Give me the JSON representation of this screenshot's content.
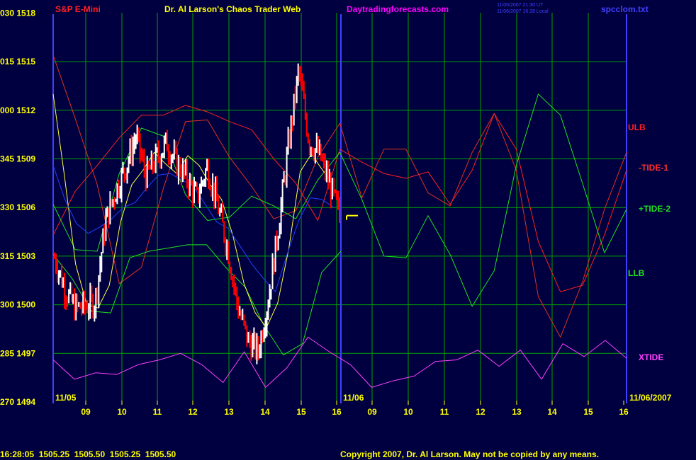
{
  "header": {
    "instrument": "S&P E-Mini",
    "title": "Dr. Al Larson's Chaos Trader Web",
    "site": "Daytradingforecasts.com",
    "time_line_1": "11/05/2007 21:30 UT",
    "time_line_2": "11/06/2007 16:28 Local",
    "file": "spcclom.txt"
  },
  "footer": {
    "quote": "16:28:05  1505.25  1505.50  1505.25  1505.50",
    "copyright": "Copyright 2007, Dr. Al Larson. May not be copied by any means."
  },
  "colors": {
    "background": "#000040",
    "grid": "#00A000",
    "axis": "#4040FF",
    "yellow": "#FFFF00",
    "magenta": "#FF00FF",
    "ulb": "#FF2020",
    "tide1": "#E03020",
    "tide2": "#20E020",
    "llb": "#20E020",
    "xtide": "#FF40FF",
    "price_up": "#FFFFFF",
    "price_down": "#FF0000",
    "ma_yellow": "#FFFF40",
    "ma_blue": "#2040FF"
  },
  "chart_data": {
    "type": "line",
    "y_axis_ticks": [
      {
        "osc": "030",
        "price": "1518"
      },
      {
        "osc": "015",
        "price": "1515"
      },
      {
        "osc": "000",
        "price": "1512"
      },
      {
        "osc": "345",
        "price": "1509"
      },
      {
        "osc": "330",
        "price": "1506"
      },
      {
        "osc": "315",
        "price": "1503"
      },
      {
        "osc": "300",
        "price": "1500"
      },
      {
        "osc": "285",
        "price": "1497"
      },
      {
        "osc": "270",
        "price": "1494"
      }
    ],
    "ylim": [
      1494,
      1518
    ],
    "x_tick_labels": [
      "09",
      "10",
      "11",
      "12",
      "13",
      "14",
      "15",
      "16",
      "09",
      "10",
      "11",
      "12",
      "13",
      "14",
      "15",
      "16"
    ],
    "date_labels": {
      "day1": "11/05",
      "day2": "11/06",
      "right": "11/06/2007"
    },
    "line_labels": [
      {
        "name": "ULB",
        "color": "#FF2020"
      },
      {
        "name": "-TIDE-1",
        "color": "#FF3030"
      },
      {
        "name": "+TIDE-2",
        "color": "#20E020"
      },
      {
        "name": "LLB",
        "color": "#20E020"
      },
      {
        "name": "XTIDE",
        "color": "#FF40FF"
      }
    ],
    "grid": true,
    "series": [
      {
        "name": "ULB",
        "values": [
          1504.3,
          1507.0,
          1508.6,
          1510.3,
          1511.7,
          1511.7,
          1512.3,
          1511.9,
          1511.3,
          1510.8,
          1509.0,
          1507.5,
          1505.2,
          1509.6,
          1508.8,
          1508.1,
          1507.8,
          1508.2,
          1506.2,
          1508.3,
          1511.8,
          1509.6,
          1503.9,
          1500.8,
          1501.2,
          1504.3,
          1508.3
        ]
      },
      {
        "name": "-TIDE-1",
        "values": [
          1515.4,
          1511.5,
          1507.4,
          1501.3,
          1502.3,
          1507.2,
          1511.3,
          1511.4,
          1509.1,
          1507.3,
          1505.3,
          1505.8,
          1509.1,
          1511.2,
          1506.6,
          1509.6,
          1509.6,
          1506.9,
          1506.1,
          1509.4,
          1511.8,
          1508.3,
          1500.5,
          1498.0,
          1501.4,
          1505.9,
          1509.4
        ]
      },
      {
        "name": "+TIDE-2",
        "values": [
          1506.2,
          1503.4,
          1503.3,
          1508.1,
          1510.9,
          1510.4,
          1506.8,
          1505.2,
          1505.4,
          1506.7,
          1506.1,
          1505.3,
          1507.7,
          1509.4,
          1506.5,
          1503.0,
          1502.9,
          1505.5,
          1503.1,
          1499.9,
          1502.1,
          1508.6,
          1513.0,
          1511.7,
          1507.5,
          1503.2,
          1505.9
        ]
      },
      {
        "name": "LLB",
        "values": [
          1503.1,
          1501.6,
          1499.6,
          1499.5,
          1502.9,
          1503.3,
          1503.5,
          1503.7,
          1503.7,
          1502.3,
          1501.1,
          1498.7,
          1496.9,
          1497.6,
          1502.0,
          1503.3
        ]
      },
      {
        "name": "XTIDE",
        "values": [
          1496.6,
          1495.4,
          1495.8,
          1495.7,
          1496.3,
          1496.6,
          1497.0,
          1496.3,
          1495.2,
          1497.1,
          1494.9,
          1496.1,
          1498.0,
          1497.1,
          1496.3,
          1494.9,
          1495.3,
          1495.6,
          1496.5,
          1496.6,
          1497.2,
          1496.2,
          1497.2,
          1495.4,
          1497.6,
          1496.8,
          1497.8,
          1496.7
        ]
      },
      {
        "name": "Price",
        "values": [
          1502.9,
          1501.0,
          1499.8,
          1499.9,
          1500.2,
          1505.1,
          1507.0,
          1508.5,
          1510.4,
          1507.9,
          1509.0,
          1510.0,
          1508.7,
          1507.8,
          1506.6,
          1508.5,
          1506.2,
          1503.5,
          1499.9,
          1497.8,
          1497.1,
          1500.3,
          1504.8,
          1509.9,
          1514.5,
          1510.1,
          1509.3,
          1507.5,
          1505.5
        ]
      },
      {
        "name": "MA-Yellow",
        "values": [
          1513.0,
          1508.0,
          1502.5,
          1500.0,
          1499.8,
          1501.2,
          1505.1,
          1507.4,
          1508.3,
          1509.4,
          1508.7,
          1508.1,
          1509.2,
          1508.6,
          1507.4,
          1506.5,
          1504.3,
          1501.3,
          1499.5,
          1498.6,
          1500.1,
          1503.5,
          1508.2,
          1509.3,
          1508.3,
          1507.4
        ]
      },
      {
        "name": "MA-Blue",
        "values": [
          1508.6,
          1506.5,
          1505.0,
          1504.4,
          1504.8,
          1505.3,
          1506.0,
          1506.3,
          1507.2,
          1508.0,
          1508.1,
          1507.7,
          1507.3,
          1506.2,
          1505.1,
          1504.7,
          1503.6,
          1502.5,
          1501.6,
          1500.8,
          1503.1,
          1505.2,
          1506.6,
          1506.5,
          1506.0
        ]
      }
    ],
    "last_price_marker": 1505.5
  }
}
